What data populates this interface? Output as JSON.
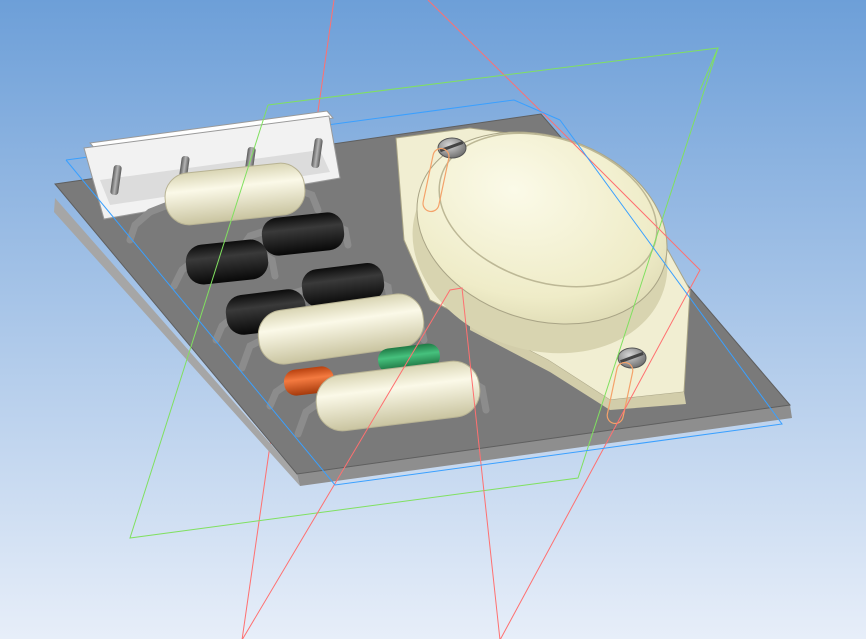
{
  "viewport": {
    "background_top": "#6d9fd8",
    "background_bottom": "#e7eef9"
  },
  "colors": {
    "board_top": "#7c7c7c",
    "board_front": "#9f9f9f",
    "board_side": "#8d8d8d",
    "cream_body": "#f3f0d6",
    "cream_shadow": "#d6d2b0",
    "black_body": "#1d1d1d",
    "green_body": "#2e9e5e",
    "orange_body": "#e2571e",
    "lead": "#8c8c8c",
    "header": "#f4f4f4",
    "plane_red": "#ff7070",
    "plane_green": "#80e060",
    "plane_blue": "#3aa0ff",
    "orange_outline": "#f4a26a"
  },
  "icons": {
    "standoff_top": "screw-head-icon",
    "standoff_bottom": "screw-head-icon"
  }
}
